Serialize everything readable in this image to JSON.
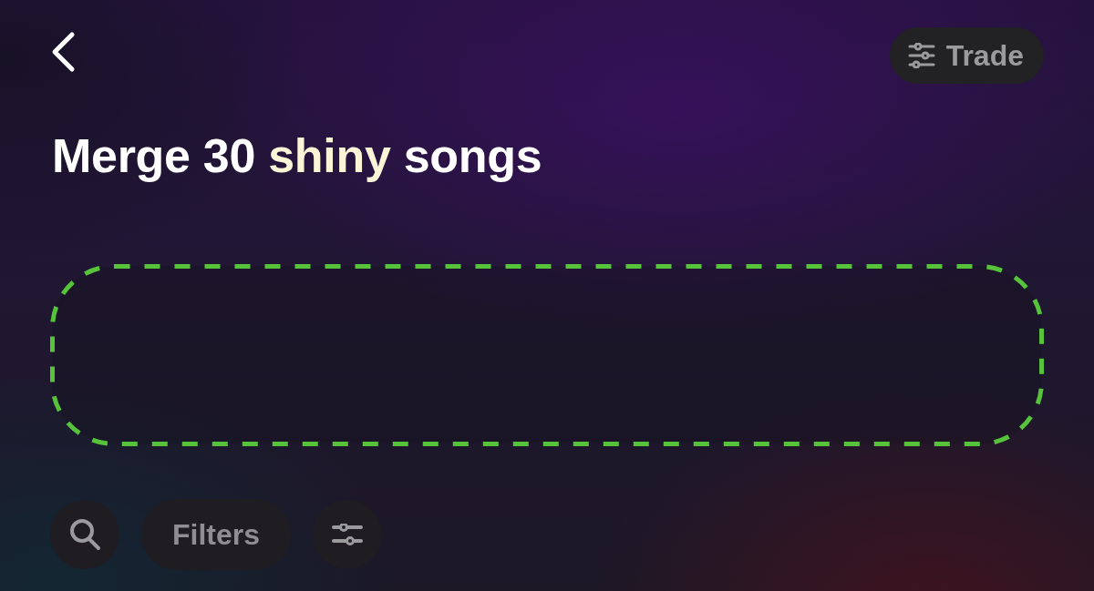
{
  "trade_button": {
    "label": "Trade"
  },
  "title": [
    {
      "text": "Merge 30 ",
      "kind": "plain"
    },
    {
      "text": "shiny",
      "kind": "highlight"
    },
    {
      "text": " songs",
      "kind": "plain"
    }
  ],
  "toolbar": {
    "filters_button": {
      "label": "Filters"
    }
  }
}
